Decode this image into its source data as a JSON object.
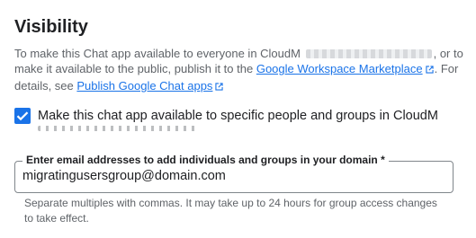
{
  "section": {
    "title": "Visibility"
  },
  "description": {
    "part1": "To make this Chat app available to everyone in CloudM",
    "part2": ", or to make it available to the public, publish it to the",
    "marketplace_link": "Google Workspace Marketplace",
    "part3": ". For details, see",
    "publish_link": "Publish Google Chat apps"
  },
  "checkbox": {
    "label": "Make this chat app available to specific people and groups in CloudM",
    "checked": true,
    "color": "#1a73e8"
  },
  "email_field": {
    "label": "Enter email addresses to add individuals and groups in your domain *",
    "value": "migratingusersgroup@domain.com",
    "helper": "Separate multiples with commas. It may take up to 24 hours for group access changes to take effect."
  },
  "colors": {
    "link": "#1a73e8",
    "text_primary": "#202124",
    "text_secondary": "#5f6368"
  }
}
